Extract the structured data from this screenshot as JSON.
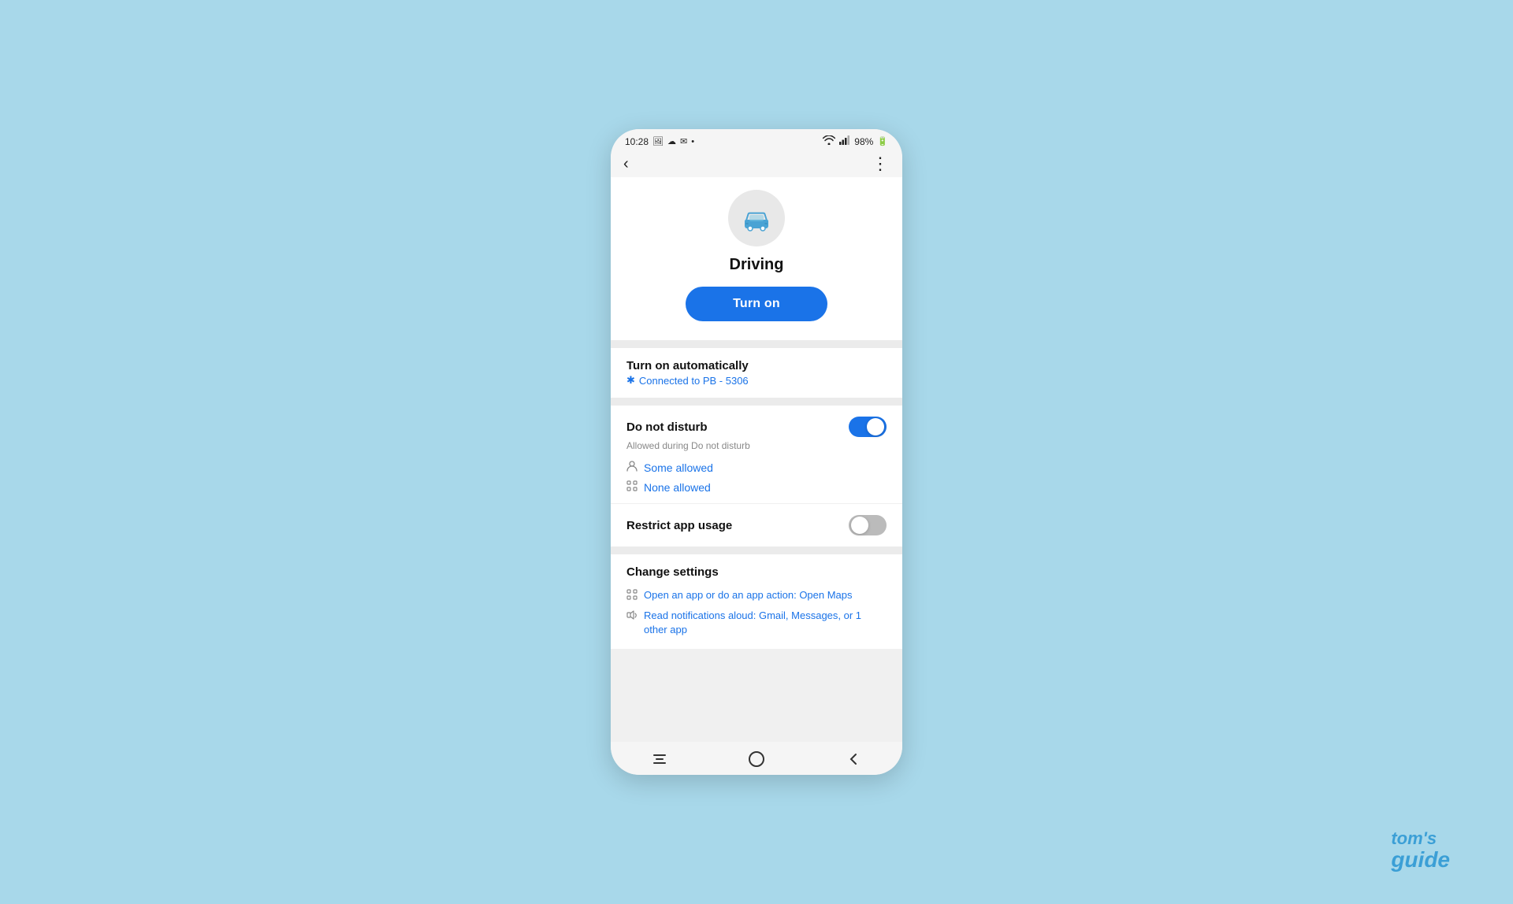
{
  "statusBar": {
    "time": "10:28",
    "battery": "98%",
    "wifi": true,
    "signal": true
  },
  "topBar": {
    "backLabel": "‹",
    "moreLabel": "⋮"
  },
  "hero": {
    "title": "Driving",
    "turnOnLabel": "Turn on"
  },
  "turnOnAutomatically": {
    "title": "Turn on automatically",
    "subtitle": "Connected to PB - 5306"
  },
  "doNotDisturb": {
    "label": "Do not disturb",
    "toggleOn": true,
    "subtext": "Allowed during Do not disturb",
    "items": [
      {
        "icon": "👤",
        "label": "Some allowed"
      },
      {
        "icon": "⚙",
        "label": "None allowed"
      }
    ]
  },
  "restrictAppUsage": {
    "label": "Restrict app usage",
    "toggleOn": false
  },
  "changeSettings": {
    "title": "Change settings",
    "items": [
      {
        "icon": "⚙",
        "label": "Open an app or do an app action: Open Maps"
      },
      {
        "icon": "🔊",
        "label": "Read notifications aloud: Gmail, Messages, or 1 other app"
      }
    ]
  },
  "bottomNav": {
    "menu": "menu",
    "home": "home",
    "back": "back"
  },
  "watermark": {
    "line1": "tom's",
    "line2": "guide"
  }
}
